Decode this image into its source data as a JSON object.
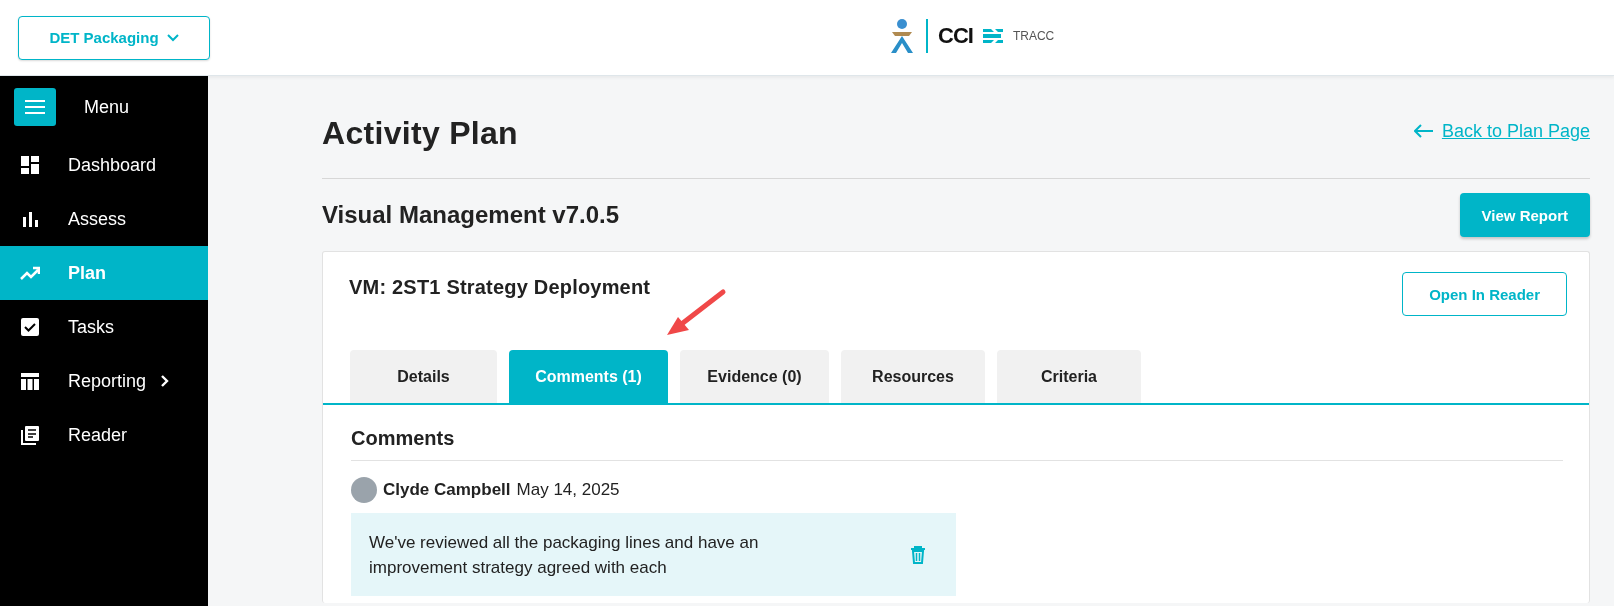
{
  "org_selector": {
    "label": "DET Packaging"
  },
  "logo": {
    "brand": "CCI",
    "product": "TRACC"
  },
  "sidebar": {
    "menu_label": "Menu",
    "items": [
      {
        "label": "Dashboard",
        "kind": "dashboard",
        "selected": false,
        "has_submenu": false
      },
      {
        "label": "Assess",
        "kind": "bars",
        "selected": false,
        "has_submenu": false
      },
      {
        "label": "Plan",
        "kind": "trend",
        "selected": true,
        "has_submenu": false
      },
      {
        "label": "Tasks",
        "kind": "check",
        "selected": false,
        "has_submenu": false
      },
      {
        "label": "Reporting",
        "kind": "table",
        "selected": false,
        "has_submenu": true
      },
      {
        "label": "Reader",
        "kind": "doc",
        "selected": false,
        "has_submenu": false
      }
    ]
  },
  "page": {
    "title": "Activity Plan",
    "back_link": "Back to Plan Page",
    "plan_name": "Visual Management v7.0.5",
    "view_report_button": "View Report"
  },
  "activity": {
    "title": "VM: 2ST1 Strategy Deployment",
    "open_reader_button": "Open In Reader",
    "annotation": {
      "kind": "arrow"
    },
    "tabs": [
      {
        "label": "Details",
        "selected": false
      },
      {
        "label": "Comments (1)",
        "selected": true
      },
      {
        "label": "Evidence (0)",
        "selected": false
      },
      {
        "label": "Resources",
        "selected": false
      },
      {
        "label": "Criteria",
        "selected": false
      }
    ],
    "section_title": "Comments",
    "comments": [
      {
        "author": "Clyde Campbell",
        "date": "May 14, 2025",
        "text": "We've reviewed all the packaging lines and have an improvement strategy agreed with each"
      }
    ]
  }
}
